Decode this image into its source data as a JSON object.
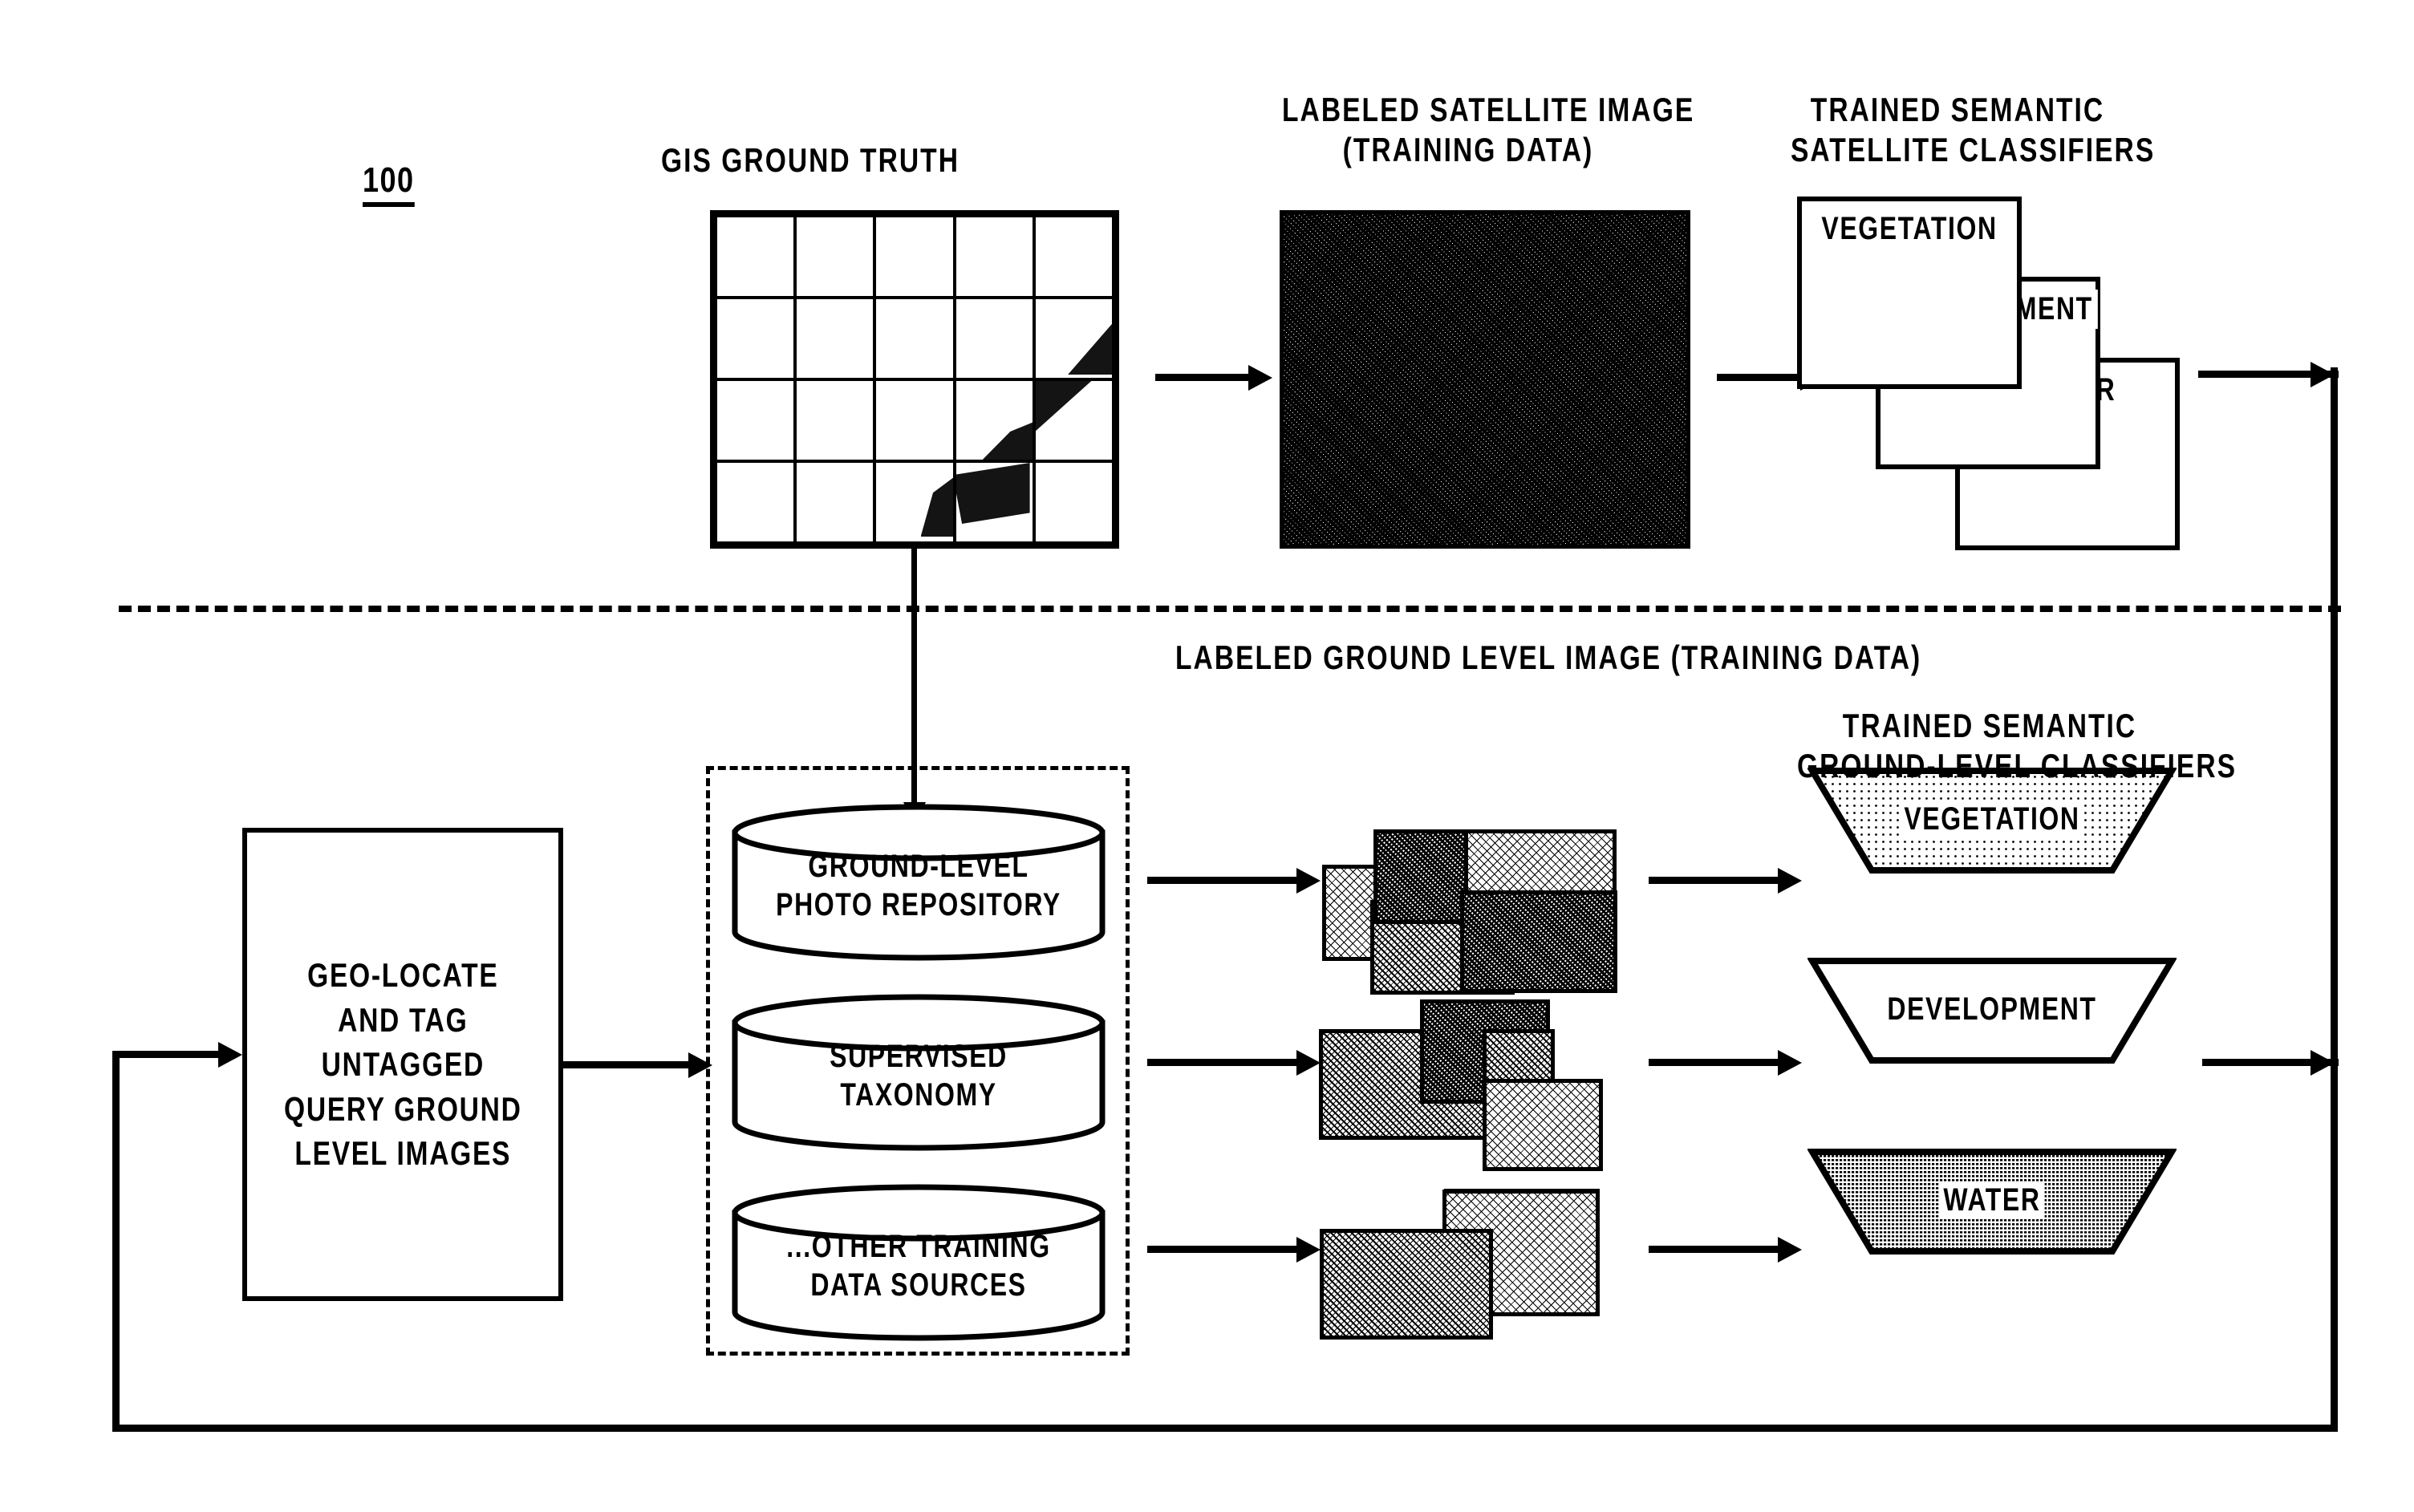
{
  "figure": {
    "number": "100"
  },
  "headers": {
    "gis_ground_truth": "GIS GROUND TRUTH",
    "labeled_satellite_image": "LABELED SATELLITE IMAGE\n(TRAINING DATA)",
    "trained_satellite_classifiers": "TRAINED SEMANTIC\nSATELLITE CLASSIFIERS",
    "labeled_ground_level_image": "LABELED GROUND LEVEL IMAGE (TRAINING DATA)",
    "trained_ground_level_classifiers": "TRAINED SEMANTIC\nGROUND-LEVEL CLASSIFIERS"
  },
  "satellite_classifiers": [
    {
      "label": "VEGETATION",
      "fill": "dotted-light"
    },
    {
      "label": "DEVELOPMENT",
      "fill": "white"
    },
    {
      "label": "WATER",
      "fill": "dense-dark"
    }
  ],
  "ground_level_classifiers": [
    {
      "label": "VEGETATION",
      "fill": "dotted-light"
    },
    {
      "label": "DEVELOPMENT",
      "fill": "white"
    },
    {
      "label": "WATER",
      "fill": "dense-dark"
    }
  ],
  "process_box": {
    "label": "GEO-LOCATE\nAND TAG\nUNTAGGED\nQUERY GROUND\nLEVEL IMAGES"
  },
  "data_sources": [
    {
      "label": "GROUND-LEVEL\nPHOTO REPOSITORY"
    },
    {
      "label": "SUPERVISED\nTAXONOMY"
    },
    {
      "label": "...OTHER TRAINING\nDATA SOURCES"
    }
  ],
  "colors": {
    "stroke": "#000000",
    "background": "#ffffff"
  },
  "icons": {
    "arrow_right": "arrow-right-icon",
    "arrow_down": "arrow-down-icon",
    "database_cylinder": "database-cylinder-icon",
    "divider_dashed": "dashed-divider-icon"
  }
}
